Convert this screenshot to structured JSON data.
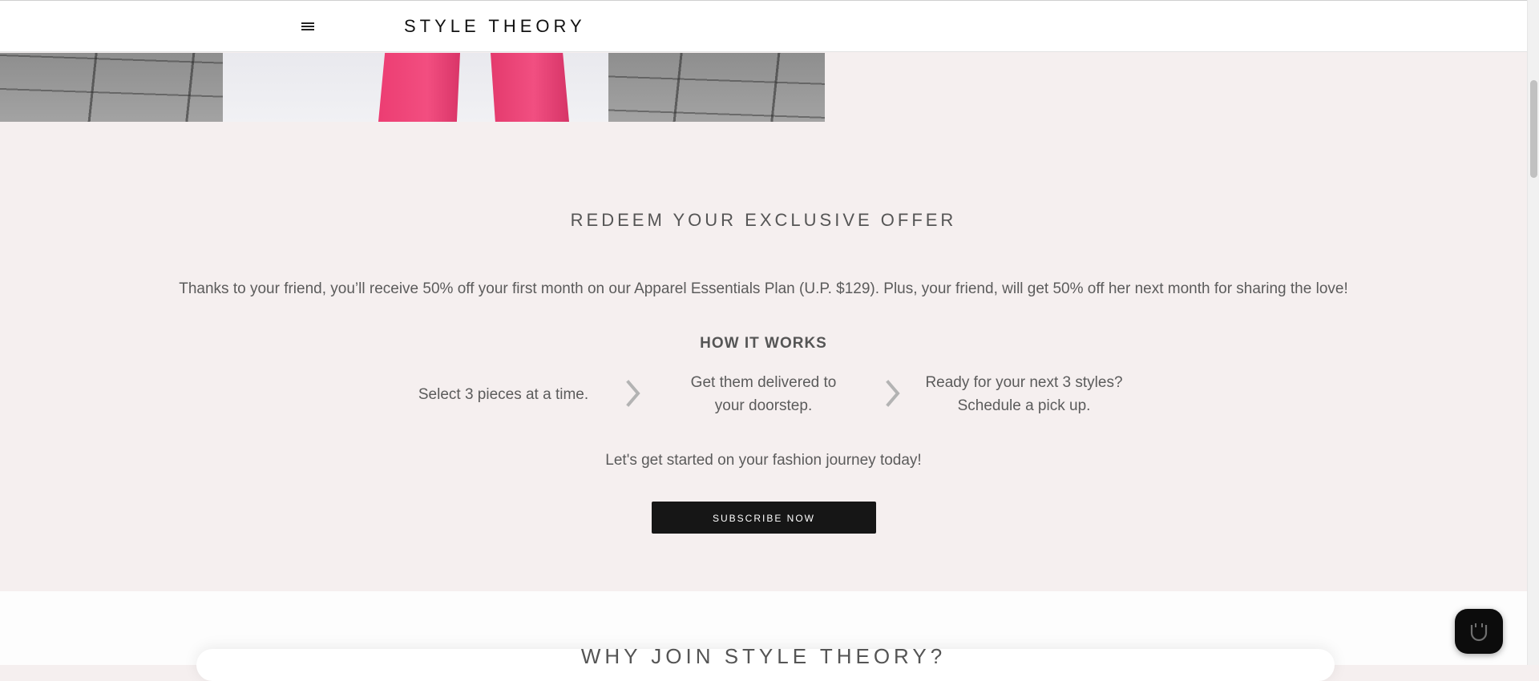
{
  "header": {
    "menu_icon": "hamburger-menu-icon",
    "logo": "STYLE THEORY"
  },
  "hero": {
    "image_description_icon": "hero-photo"
  },
  "offer": {
    "title": "REDEEM YOUR EXCLUSIVE OFFER",
    "text": "Thanks to your friend, you’ll receive 50% off your first month on our Apparel Essentials Plan (U.P. $129). Plus, your friend, will get 50% off her next month for sharing the love!"
  },
  "how_it_works": {
    "title": "HOW IT WORKS",
    "steps": [
      {
        "text": "Select 3 pieces at a time."
      },
      {
        "line1": "Get them delivered to",
        "line2": "your doorstep."
      },
      {
        "line1": "Ready for your next 3 styles?",
        "line2": "Schedule a pick up."
      }
    ]
  },
  "cta": {
    "text": "Let's get started on your fashion journey today!",
    "button_label": "SUBSCRIBE NOW"
  },
  "why_join": {
    "title": "WHY JOIN STYLE THEORY?"
  },
  "chat": {
    "icon": "chat-icon"
  },
  "colors": {
    "page_bg": "#f5efef",
    "button_bg": "#161616",
    "accent_pink": "#f24e80"
  }
}
